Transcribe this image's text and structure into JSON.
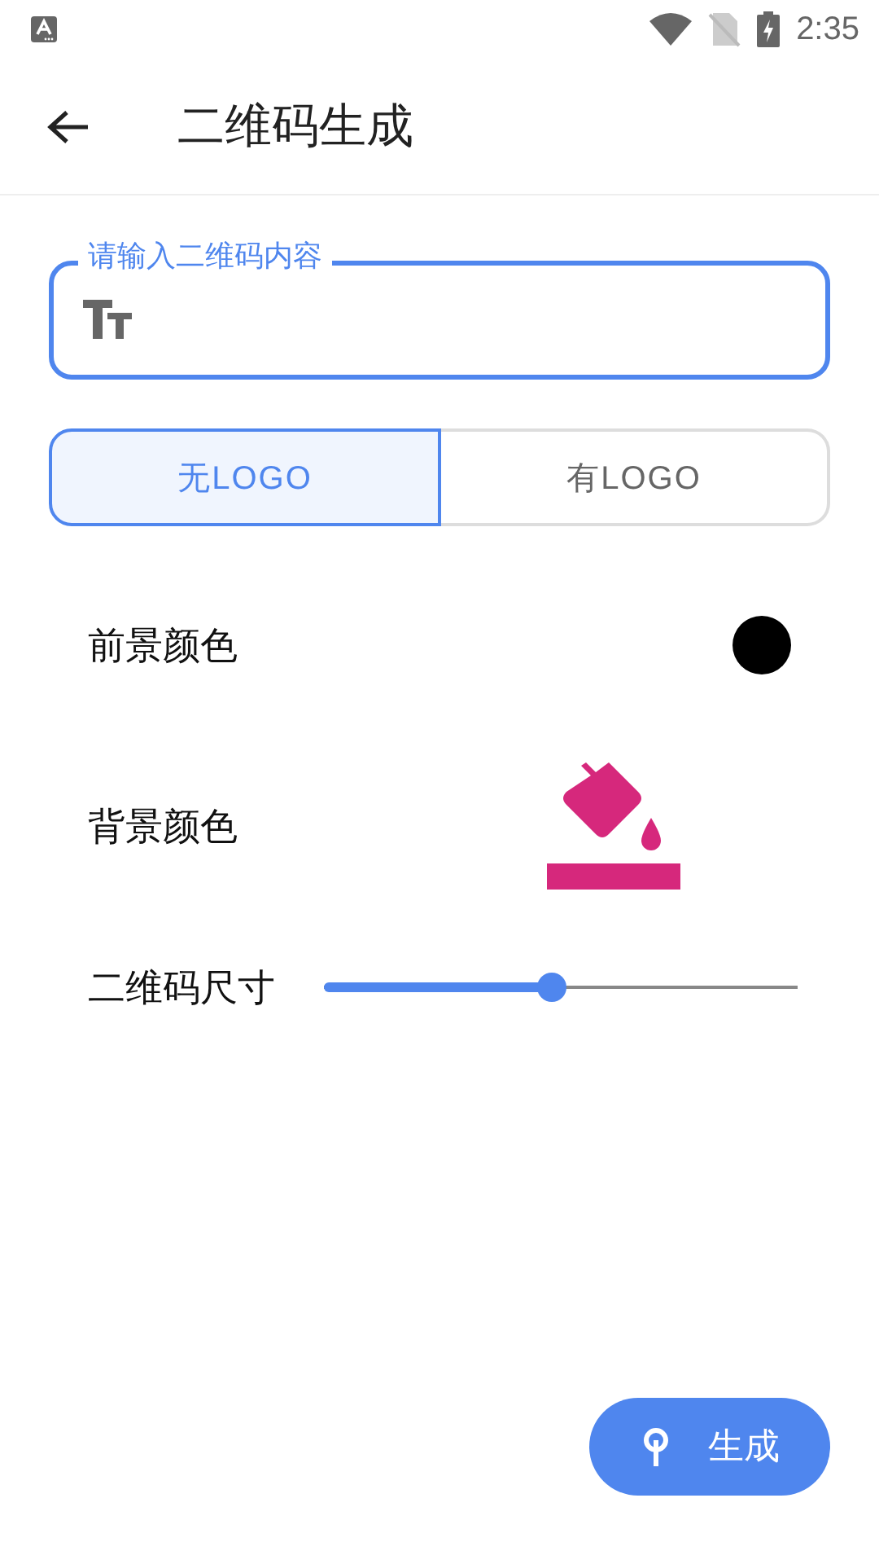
{
  "status_bar": {
    "time": "2:35"
  },
  "toolbar": {
    "title": "二维码生成"
  },
  "content_field": {
    "label": "请输入二维码内容"
  },
  "logo_toggle": [
    {
      "label": "无LOGO",
      "selected": true
    },
    {
      "label": "有LOGO",
      "selected": false
    }
  ],
  "settings": [
    {
      "kind": "swatch",
      "label": "前景颜色",
      "color": "#000000"
    },
    {
      "kind": "bucket",
      "label": "背景颜色",
      "color": "#d6287c"
    },
    {
      "kind": "slider",
      "label": "二维码尺寸",
      "level": 0.48
    }
  ],
  "fab": {
    "label": "生成"
  }
}
